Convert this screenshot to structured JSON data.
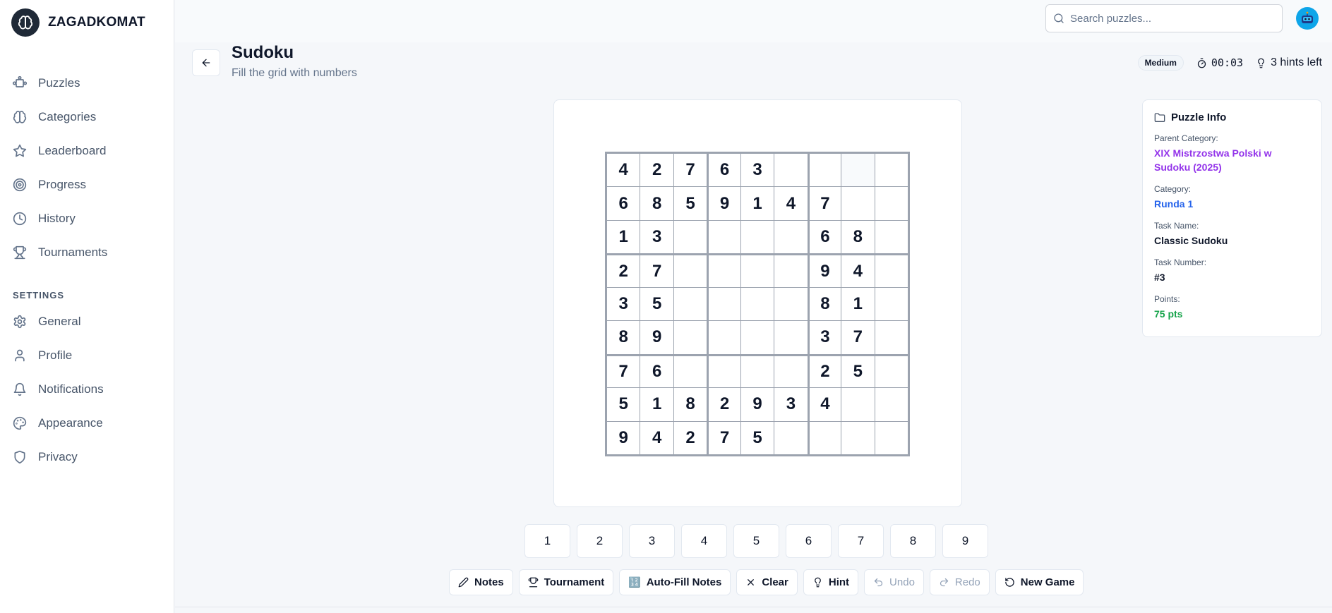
{
  "app": {
    "brand_name": "ZAGADKOMAT"
  },
  "sidebar": {
    "items": [
      {
        "label": "Puzzles",
        "icon": "puzzle-icon"
      },
      {
        "label": "Categories",
        "icon": "brain-icon"
      },
      {
        "label": "Leaderboard",
        "icon": "star-icon"
      },
      {
        "label": "Progress",
        "icon": "target-icon"
      },
      {
        "label": "History",
        "icon": "clock-icon"
      },
      {
        "label": "Tournaments",
        "icon": "trophy-icon"
      }
    ],
    "settings_heading": "SETTINGS",
    "settings_items": [
      {
        "label": "General",
        "icon": "gear-icon"
      },
      {
        "label": "Profile",
        "icon": "user-icon"
      },
      {
        "label": "Notifications",
        "icon": "bell-icon"
      },
      {
        "label": "Appearance",
        "icon": "palette-icon"
      },
      {
        "label": "Privacy",
        "icon": "shield-icon"
      }
    ]
  },
  "search": {
    "placeholder": "Search puzzles...",
    "value": ""
  },
  "page": {
    "title": "Sudoku",
    "subtitle": "Fill the grid with numbers"
  },
  "status": {
    "difficulty": "Medium",
    "timer": "00:03",
    "hints": "3 hints left"
  },
  "grid": [
    [
      "4",
      "2",
      "7",
      "6",
      "3",
      "",
      "",
      "",
      ""
    ],
    [
      "6",
      "8",
      "5",
      "9",
      "1",
      "4",
      "7",
      "",
      ""
    ],
    [
      "1",
      "3",
      "",
      "",
      "",
      "",
      "6",
      "8",
      ""
    ],
    [
      "2",
      "7",
      "",
      "",
      "",
      "",
      "9",
      "4",
      ""
    ],
    [
      "3",
      "5",
      "",
      "",
      "",
      "",
      "8",
      "1",
      ""
    ],
    [
      "8",
      "9",
      "",
      "",
      "",
      "",
      "3",
      "7",
      ""
    ],
    [
      "7",
      "6",
      "",
      "",
      "",
      "",
      "2",
      "5",
      ""
    ],
    [
      "5",
      "1",
      "8",
      "2",
      "9",
      "3",
      "4",
      "",
      ""
    ],
    [
      "9",
      "4",
      "2",
      "7",
      "5",
      "",
      "",
      "",
      ""
    ]
  ],
  "numpad": [
    "1",
    "2",
    "3",
    "4",
    "5",
    "6",
    "7",
    "8",
    "9"
  ],
  "toolbar": {
    "notes": "Notes",
    "tournament": "Tournament",
    "autofill": "Auto-Fill Notes",
    "autofill_glyph": "🔢",
    "clear": "Clear",
    "hint": "Hint",
    "undo": "Undo",
    "redo": "Redo",
    "new_game": "New Game"
  },
  "info": {
    "heading": "Puzzle Info",
    "parent_category_label": "Parent Category:",
    "parent_category": "XIX Mistrzostwa Polski w Sudoku (2025)",
    "category_label": "Category:",
    "category": "Runda 1",
    "task_name_label": "Task Name:",
    "task_name": "Classic Sudoku",
    "task_number_label": "Task Number:",
    "task_number": "#3",
    "points_label": "Points:",
    "points": "75 pts"
  },
  "colors": {
    "accent_purple": "#9333ea",
    "accent_blue": "#2563eb",
    "accent_green": "#16a34a",
    "grid_border": "#9ca3af"
  }
}
